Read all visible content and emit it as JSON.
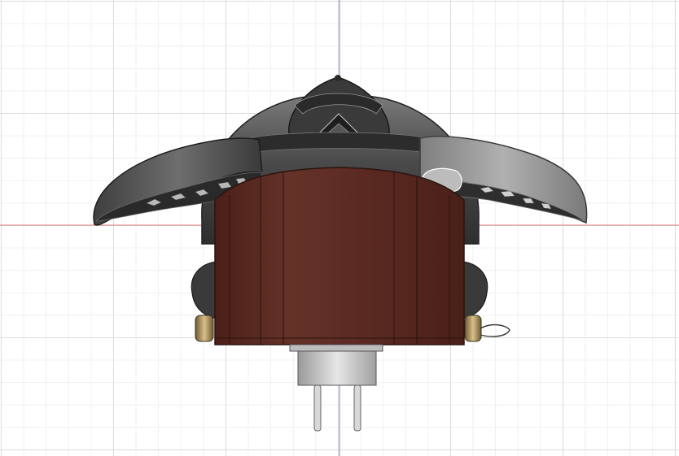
{
  "viewport": {
    "background": "#ffffff",
    "grid_major_color": "#dcdcdc",
    "grid_minor_color": "#f0f0f0",
    "axis_vertical_color": "#8080e0",
    "axis_horizontal_color": "#e08080"
  },
  "model": {
    "body_color": "#5a2a22",
    "body_edge_color": "#2a1410",
    "shell_color": "#4a4a4a",
    "shell_highlight": "#8a8a8a",
    "selected_arm_color": "#9a9a9a",
    "plug_color": "#c8c8c8",
    "pin_color": "#d8d8d8",
    "knob_color": "#b8a06a"
  }
}
